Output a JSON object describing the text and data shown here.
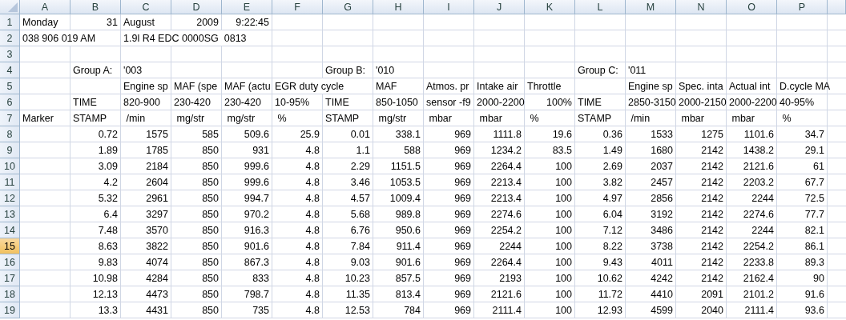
{
  "columns": [
    "A",
    "B",
    "C",
    "D",
    "E",
    "F",
    "G",
    "H",
    "I",
    "J",
    "K",
    "L",
    "M",
    "N",
    "O",
    "P"
  ],
  "rows": [
    {
      "number": "1",
      "selected": false,
      "cells": {
        "A": "Monday",
        "B": "31",
        "C": "August",
        "D": "2009",
        "E": "9:22:45"
      }
    },
    {
      "number": "2",
      "selected": false,
      "cells": {
        "A": "038 906 019 AM",
        "C": "1.9l R4 EDC 0000SG  0813"
      }
    },
    {
      "number": "3",
      "selected": false,
      "cells": {}
    },
    {
      "number": "4",
      "selected": false,
      "cells": {
        "B": "Group A:",
        "C": "'003",
        "G": "Group B:",
        "H": "'010",
        "L": "Group C:",
        "M": "'011"
      }
    },
    {
      "number": "5",
      "selected": false,
      "cells": {
        "C": "Engine sp",
        "D": "MAF (spe",
        "E": "MAF (actu",
        "F": "EGR duty cycle",
        "H": "MAF",
        "I": "Atmos. pr",
        "J": "Intake air",
        "K": "Throttle",
        "M": "Engine sp",
        "N": "Spec. inta",
        "O": "Actual int",
        "P": "D.cycle MA"
      }
    },
    {
      "number": "6",
      "selected": false,
      "cells": {
        "B": "TIME",
        "C": "820-900",
        "D": "230-420",
        "E": "230-420",
        "F": "10-95%",
        "G": "TIME",
        "H": "850-1050",
        "I": "sensor -f9",
        "J": "2000-2200",
        "K": "100%",
        "L": "TIME",
        "M": "2850-3150",
        "N": "2000-2150",
        "O": "2000-2200",
        "P": "40-95%"
      }
    },
    {
      "number": "7",
      "selected": false,
      "cells": {
        "A": "Marker",
        "B": "STAMP",
        "C": " /min",
        "D": " mg/str",
        "E": " mg/str",
        "F": " %",
        "G": "STAMP",
        "H": " mg/str",
        "I": " mbar",
        "J": " mbar",
        "K": " %",
        "L": "STAMP",
        "M": " /min",
        "N": " mbar",
        "O": " mbar",
        "P": " %"
      }
    },
    {
      "number": "8",
      "selected": false,
      "cells": {
        "B": "0.72",
        "C": "1575",
        "D": "585",
        "E": "509.6",
        "F": "25.9",
        "G": "0.01",
        "H": "338.1",
        "I": "969",
        "J": "1111.8",
        "K": "19.6",
        "L": "0.36",
        "M": "1533",
        "N": "1275",
        "O": "1101.6",
        "P": "34.7"
      }
    },
    {
      "number": "9",
      "selected": false,
      "cells": {
        "B": "1.89",
        "C": "1785",
        "D": "850",
        "E": "931",
        "F": "4.8",
        "G": "1.1",
        "H": "588",
        "I": "969",
        "J": "1234.2",
        "K": "83.5",
        "L": "1.49",
        "M": "1680",
        "N": "2142",
        "O": "1438.2",
        "P": "29.1"
      }
    },
    {
      "number": "10",
      "selected": false,
      "cells": {
        "B": "3.09",
        "C": "2184",
        "D": "850",
        "E": "999.6",
        "F": "4.8",
        "G": "2.29",
        "H": "1151.5",
        "I": "969",
        "J": "2264.4",
        "K": "100",
        "L": "2.69",
        "M": "2037",
        "N": "2142",
        "O": "2121.6",
        "P": "61"
      }
    },
    {
      "number": "11",
      "selected": false,
      "cells": {
        "B": "4.2",
        "C": "2604",
        "D": "850",
        "E": "999.6",
        "F": "4.8",
        "G": "3.46",
        "H": "1053.5",
        "I": "969",
        "J": "2213.4",
        "K": "100",
        "L": "3.82",
        "M": "2457",
        "N": "2142",
        "O": "2203.2",
        "P": "67.7"
      }
    },
    {
      "number": "12",
      "selected": false,
      "cells": {
        "B": "5.32",
        "C": "2961",
        "D": "850",
        "E": "994.7",
        "F": "4.8",
        "G": "4.57",
        "H": "1009.4",
        "I": "969",
        "J": "2213.4",
        "K": "100",
        "L": "4.97",
        "M": "2856",
        "N": "2142",
        "O": "2244",
        "P": "72.5"
      }
    },
    {
      "number": "13",
      "selected": false,
      "cells": {
        "B": "6.4",
        "C": "3297",
        "D": "850",
        "E": "970.2",
        "F": "4.8",
        "G": "5.68",
        "H": "989.8",
        "I": "969",
        "J": "2274.6",
        "K": "100",
        "L": "6.04",
        "M": "3192",
        "N": "2142",
        "O": "2274.6",
        "P": "77.7"
      }
    },
    {
      "number": "14",
      "selected": false,
      "cells": {
        "B": "7.48",
        "C": "3570",
        "D": "850",
        "E": "916.3",
        "F": "4.8",
        "G": "6.76",
        "H": "950.6",
        "I": "969",
        "J": "2254.2",
        "K": "100",
        "L": "7.12",
        "M": "3486",
        "N": "2142",
        "O": "2244",
        "P": "82.1"
      }
    },
    {
      "number": "15",
      "selected": true,
      "cells": {
        "B": "8.63",
        "C": "3822",
        "D": "850",
        "E": "901.6",
        "F": "4.8",
        "G": "7.84",
        "H": "911.4",
        "I": "969",
        "J": "2244",
        "K": "100",
        "L": "8.22",
        "M": "3738",
        "N": "2142",
        "O": "2254.2",
        "P": "86.1"
      }
    },
    {
      "number": "16",
      "selected": false,
      "cells": {
        "B": "9.83",
        "C": "4074",
        "D": "850",
        "E": "867.3",
        "F": "4.8",
        "G": "9.03",
        "H": "901.6",
        "I": "969",
        "J": "2264.4",
        "K": "100",
        "L": "9.43",
        "M": "4011",
        "N": "2142",
        "O": "2233.8",
        "P": "89.3"
      }
    },
    {
      "number": "17",
      "selected": false,
      "cells": {
        "B": "10.98",
        "C": "4284",
        "D": "850",
        "E": "833",
        "F": "4.8",
        "G": "10.23",
        "H": "857.5",
        "I": "969",
        "J": "2193",
        "K": "100",
        "L": "10.62",
        "M": "4242",
        "N": "2142",
        "O": "2162.4",
        "P": "90"
      }
    },
    {
      "number": "18",
      "selected": false,
      "cells": {
        "B": "12.13",
        "C": "4473",
        "D": "850",
        "E": "798.7",
        "F": "4.8",
        "G": "11.35",
        "H": "813.4",
        "I": "969",
        "J": "2121.6",
        "K": "100",
        "L": "11.72",
        "M": "4410",
        "N": "2091",
        "O": "2101.2",
        "P": "91.6"
      }
    },
    {
      "number": "19",
      "selected": false,
      "cells": {
        "B": "13.3",
        "C": "4431",
        "D": "850",
        "E": "735",
        "F": "4.8",
        "G": "12.53",
        "H": "784",
        "I": "969",
        "J": "2111.4",
        "K": "100",
        "L": "12.93",
        "M": "4599",
        "N": "2040",
        "O": "2111.4",
        "P": "93.6"
      }
    }
  ]
}
